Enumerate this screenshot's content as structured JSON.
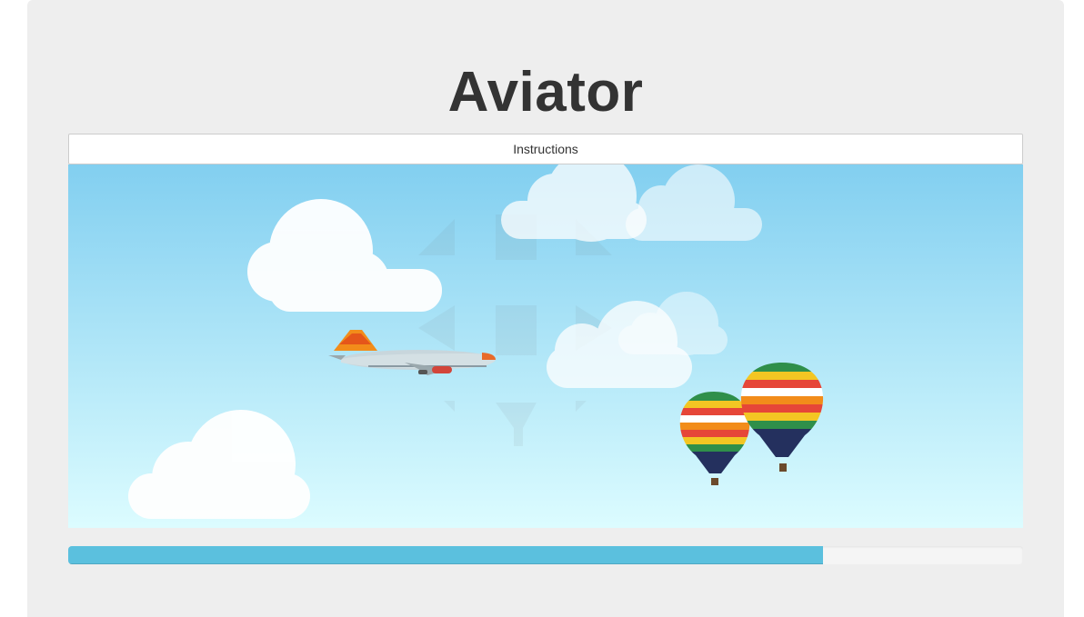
{
  "app": {
    "title": "Aviator"
  },
  "instructions": {
    "label": "Instructions"
  },
  "game": {
    "sky_top_color": "#82cff0",
    "sky_bottom_color": "#dcfcff",
    "sprites": [
      "airplane",
      "hot-air-balloon",
      "hot-air-balloon",
      "cloud",
      "cloud",
      "cloud",
      "cloud",
      "cloud"
    ]
  },
  "progress": {
    "value_percent": 79,
    "color": "#5bc0de"
  }
}
